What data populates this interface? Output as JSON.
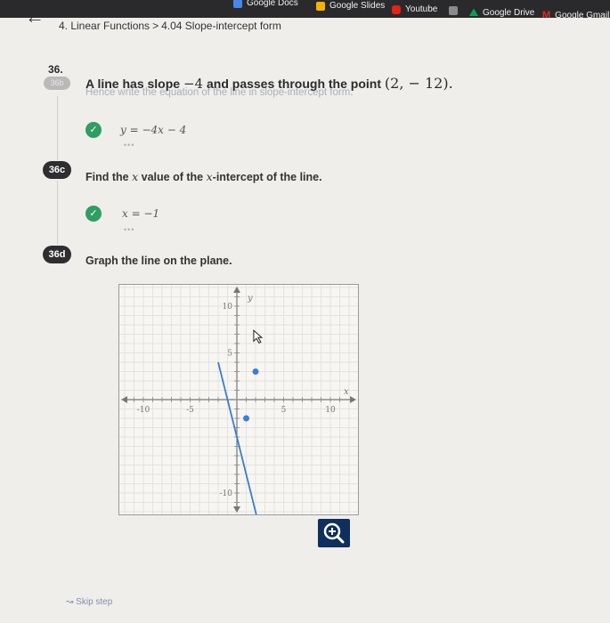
{
  "bookmarks": {
    "docs": "Google Docs",
    "slides": "Google Slides",
    "youtube": "Youtube",
    "drive": "Google Drive",
    "gmail": "Google Gmail"
  },
  "colors": {
    "check_green": "#2f9e63",
    "line_blue": "#3a7fd0",
    "zoom_navy": "#0f2f5c",
    "badge_dark": "#2e2e30"
  },
  "header": {
    "back_icon": "left-arrow-icon",
    "breadcrumb_section": "4. Linear Functions",
    "breadcrumb_separator": ">",
    "breadcrumb_lesson": "4.04 Slope-intercept form"
  },
  "question": {
    "number": "36.",
    "sub_badge": "36b",
    "text_prefix": "A line has slope",
    "slope": "−4",
    "text_middle": "and passes through the point",
    "point": "(2,  − 12).",
    "hint": "Hence write the equation of the line in slope-intercept form."
  },
  "steps": [
    {
      "badge": "",
      "answer": "y = −4x − 4",
      "dots": "•••",
      "status_icon": "check-icon"
    },
    {
      "badge": "36c",
      "prompt_before": "Find the",
      "prompt_var1": "x",
      "prompt_middle": "value of the",
      "prompt_var2": "x",
      "prompt_after": "-intercept of the line.",
      "answer": "x = −1",
      "dots": "•••",
      "status_icon": "check-icon"
    },
    {
      "badge": "36d",
      "prompt": "Graph the line on the plane."
    }
  ],
  "chart_data": {
    "type": "line",
    "xlim": [
      -12,
      12
    ],
    "ylim": [
      -12,
      12
    ],
    "x_ticks": [
      "-10",
      "-5",
      "5",
      "10"
    ],
    "y_ticks": [
      "10",
      "5",
      "-10"
    ],
    "axis_labels": {
      "x": "x",
      "y": "y"
    },
    "grid": true,
    "series": [
      {
        "values": [
          [
            -2,
            4
          ],
          [
            4,
            -20
          ]
        ]
      }
    ],
    "points": [
      [
        1,
        -2
      ],
      [
        2,
        3
      ]
    ],
    "cursor_icon": "cursor-arrow-icon"
  },
  "zoom": {
    "icon": "zoom-in-icon"
  },
  "footer": {
    "skip_label": "Skip step",
    "skip_icon": "skip-arrow-icon"
  }
}
